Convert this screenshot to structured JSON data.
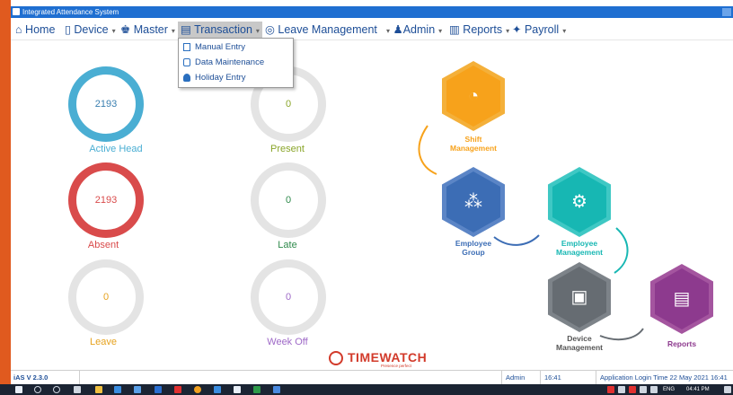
{
  "window": {
    "title": "Integrated Attendance System"
  },
  "menu": [
    {
      "id": "home",
      "label": "Home",
      "icon": "home-icon"
    },
    {
      "id": "device",
      "label": "Device",
      "icon": "device-icon"
    },
    {
      "id": "master",
      "label": "Master",
      "icon": "master-icon"
    },
    {
      "id": "transaction",
      "label": "Transaction",
      "icon": "transaction-icon"
    },
    {
      "id": "leave",
      "label": "Leave Management",
      "icon": "leave-icon"
    },
    {
      "id": "admin",
      "label": "Admin",
      "icon": "admin-icon"
    },
    {
      "id": "reports",
      "label": "Reports",
      "icon": "reports-icon"
    },
    {
      "id": "payroll",
      "label": "Payroll",
      "icon": "payroll-icon"
    }
  ],
  "transaction_menu": {
    "items": [
      {
        "label": "Manual Entry",
        "icon": "manual-entry-icon"
      },
      {
        "label": "Data Maintenance",
        "icon": "data-maintenance-icon"
      },
      {
        "label": "Holiday Entry",
        "icon": "holiday-entry-icon"
      }
    ]
  },
  "stats": {
    "active_head": {
      "value": "2193",
      "label": "Active Head",
      "color": "#4aaed3"
    },
    "present": {
      "value": "0",
      "label": "Present",
      "color": "#8aa52a"
    },
    "absent": {
      "value": "2193",
      "label": "Absent",
      "color": "#d94b4b"
    },
    "late": {
      "value": "0",
      "label": "Late",
      "color": "#2f8a4c"
    },
    "leave": {
      "value": "0",
      "label": "Leave",
      "color": "#e6a21e"
    },
    "week_off": {
      "value": "0",
      "label": "Week Off",
      "color": "#9e69c7"
    }
  },
  "workflow": {
    "shift": {
      "label_line1": "Shift",
      "label_line2": "Management",
      "color": "#f7a21b",
      "icon": "shift-management-icon"
    },
    "group": {
      "label_line1": "Employee",
      "label_line2": "Group",
      "color": "#3c6db5",
      "icon": "employee-group-icon"
    },
    "employee": {
      "label_line1": "Employee",
      "label_line2": "Management",
      "color": "#17b7b3",
      "icon": "employee-management-icon"
    },
    "device": {
      "label_line1": "Device",
      "label_line2": "Management",
      "color": "#666c72",
      "icon": "device-management-icon"
    },
    "reports": {
      "label_line1": "Reports",
      "label_line2": "",
      "color": "#8d3a8e",
      "icon": "reports-icon"
    }
  },
  "brand": {
    "name": "TIMEWATCH",
    "tagline": "Presence perfect",
    "color": "#d23a2a"
  },
  "status": {
    "version": "iAS V 2.3.0",
    "user": "Admin",
    "time": "16:41",
    "login": "Application Login Time 22 May 2021 16:41"
  },
  "taskbar": {
    "language": "ENG",
    "clock": "04:41 PM"
  }
}
